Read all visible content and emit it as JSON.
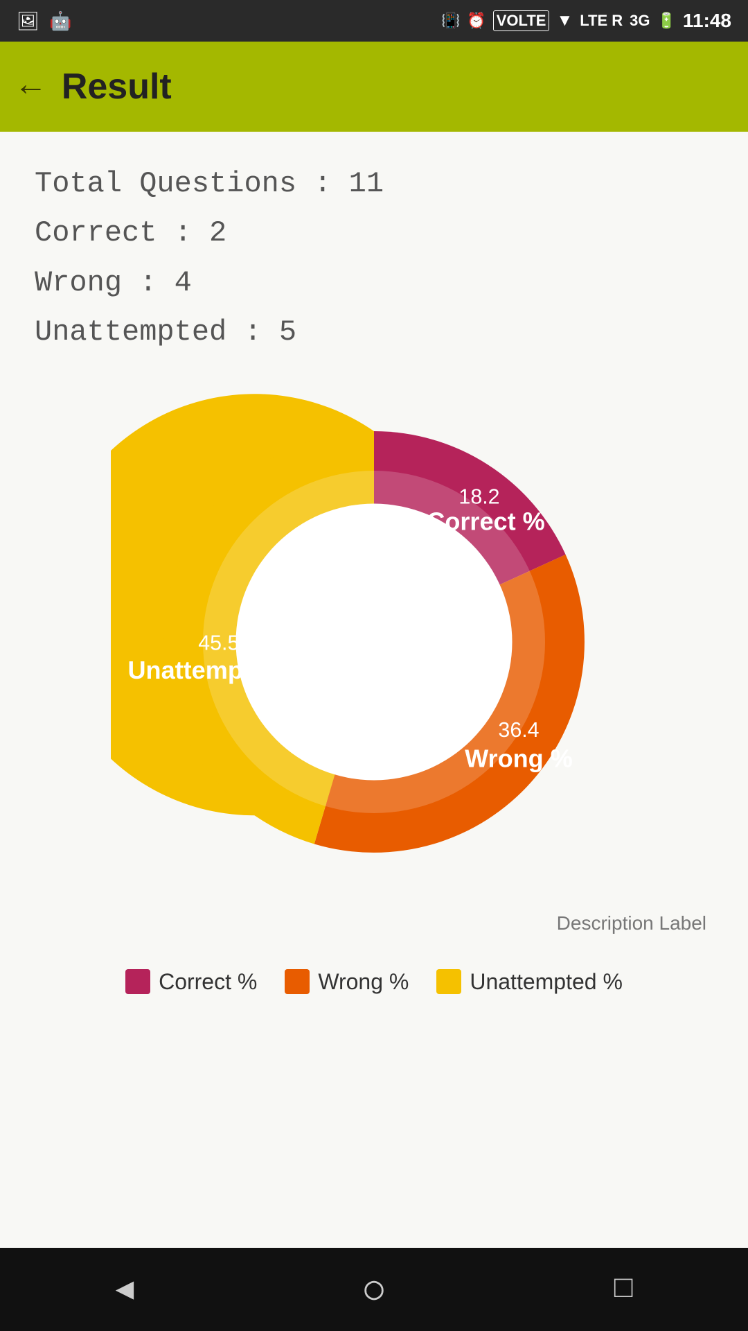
{
  "statusBar": {
    "time": "11:48",
    "icons": [
      "📷",
      "🤖",
      "📳",
      "🕐",
      "VOLTE",
      "▼",
      "LTE R",
      "3G",
      "🔋"
    ]
  },
  "appBar": {
    "title": "Result",
    "backLabel": "←"
  },
  "stats": {
    "totalLabel": "Total Questions : 11",
    "correctLabel": "Correct : 2",
    "wrongLabel": "Wrong : 4",
    "unattemptedLabel": "Unattempted : 5"
  },
  "chart": {
    "correctPercent": 18.2,
    "wrongPercent": 36.4,
    "unattemptedPercent": 45.5,
    "correctColor": "#b5235a",
    "wrongColor": "#e85c00",
    "unattemptedColor": "#f5c100",
    "correctLabel": "Correct %",
    "wrongLabel": "Wrong %",
    "unattemptedLabel": "Unattempted %",
    "descriptionLabel": "Description Label"
  },
  "legend": {
    "items": [
      {
        "label": "Correct %",
        "color": "#b5235a"
      },
      {
        "label": "Wrong %",
        "color": "#e85c00"
      },
      {
        "label": "Unattempted %",
        "color": "#f5c100"
      }
    ]
  }
}
